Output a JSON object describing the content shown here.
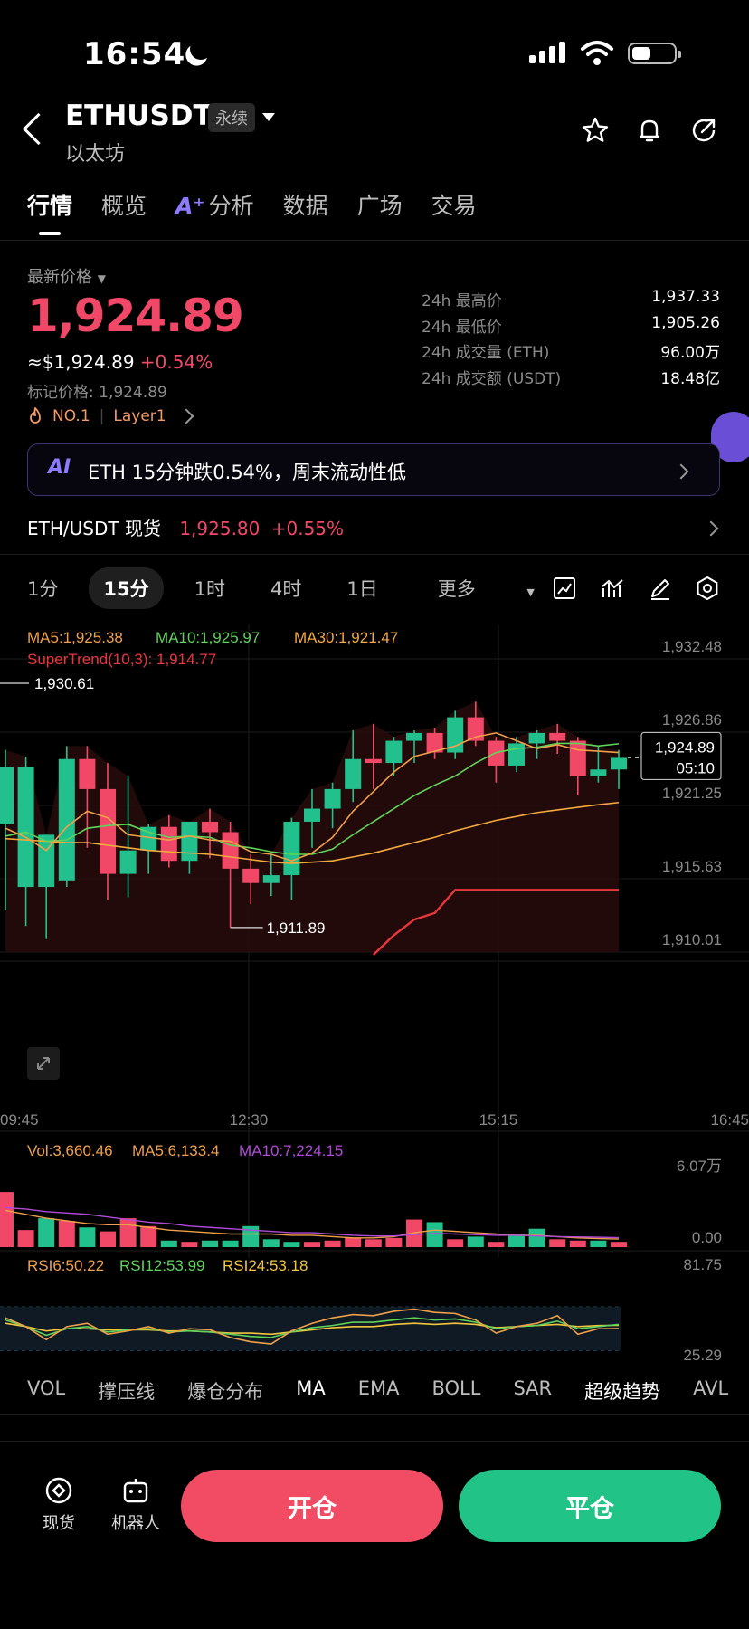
{
  "status": {
    "time": "16:54"
  },
  "header": {
    "symbol": "ETHUSDT",
    "type": "永续",
    "name": "以太坊"
  },
  "tabs": [
    "行情",
    "概览",
    "分析",
    "数据",
    "广场",
    "交易"
  ],
  "price": {
    "label": "最新价格",
    "last": "1,924.89",
    "usd": "≈$1,924.89",
    "change": "+0.54%",
    "mark": "标记价格: 1,924.89",
    "rank": "NO.1",
    "tag": "Layer1"
  },
  "stats": [
    {
      "k": "24h 最高价",
      "v": "1,937.33"
    },
    {
      "k": "24h 最低价",
      "v": "1,905.26"
    },
    {
      "k": "24h 成交量 (ETH)",
      "v": "96.00万"
    },
    {
      "k": "24h 成交额 (USDT)",
      "v": "18.48亿"
    }
  ],
  "banner": {
    "ai": "AI",
    "text": "ETH 15分钟跌0.54%，周末流动性低"
  },
  "spot": {
    "pair": "ETH/USDT 现货",
    "price": "1,925.80",
    "change": "+0.55%"
  },
  "intervals": [
    "1分",
    "15分",
    "1时",
    "4时",
    "1日",
    "更多"
  ],
  "indicators": [
    "VOL",
    "撑压线",
    "爆仓分布",
    "MA",
    "EMA",
    "BOLL",
    "SAR",
    "超级趋势",
    "AVL"
  ],
  "actions": {
    "spot": "现货",
    "bot": "机器人",
    "open": "开仓",
    "close": "平仓"
  },
  "colors": {
    "up": "#22c08c",
    "down": "#f24867",
    "ma5": "#f0a04a",
    "ma10": "#5fd35a",
    "ma30": "#f3a93e",
    "supertrend": "#e8363d"
  },
  "chart_data": {
    "type": "candlestick",
    "legend": {
      "ma5": "MA5:1,925.38",
      "ma10": "MA10:1,925.97",
      "ma30": "MA30:1,921.47",
      "supertrend": "SuperTrend(10,3): 1,914.77"
    },
    "y_ticks": [
      "1,932.48",
      "1,926.86",
      "1,921.25",
      "1,915.63",
      "1,910.01"
    ],
    "x_ticks": [
      "09:45",
      "12:30",
      "15:15",
      "16:45"
    ],
    "ylim": [
      1910.01,
      1932.48
    ],
    "last_price_label": "1,924.89",
    "countdown": "05:10",
    "high_marker": "1,930.61",
    "low_marker": "1,911.89",
    "candles": [
      {
        "o": 1919.8,
        "h": 1925.5,
        "l": 1913.2,
        "c": 1924.2
      },
      {
        "o": 1915.0,
        "h": 1925.0,
        "l": 1912.0,
        "c": 1924.2
      },
      {
        "o": 1915.0,
        "h": 1919.0,
        "l": 1911.0,
        "c": 1919.0
      },
      {
        "o": 1915.5,
        "h": 1925.8,
        "l": 1915.0,
        "c": 1924.8
      },
      {
        "o": 1924.8,
        "h": 1925.8,
        "l": 1918.0,
        "c": 1922.5
      },
      {
        "o": 1922.5,
        "h": 1924.5,
        "l": 1914.0,
        "c": 1916.0
      },
      {
        "o": 1916.0,
        "h": 1923.5,
        "l": 1914.2,
        "c": 1917.8
      },
      {
        "o": 1917.8,
        "h": 1919.8,
        "l": 1916.0,
        "c": 1919.6
      },
      {
        "o": 1919.6,
        "h": 1920.5,
        "l": 1916.5,
        "c": 1917.0
      },
      {
        "o": 1917.0,
        "h": 1920.0,
        "l": 1916.0,
        "c": 1920.0
      },
      {
        "o": 1920.0,
        "h": 1921.0,
        "l": 1917.2,
        "c": 1919.2
      },
      {
        "o": 1919.2,
        "h": 1920.0,
        "l": 1911.9,
        "c": 1916.4
      },
      {
        "o": 1916.4,
        "h": 1917.5,
        "l": 1913.7,
        "c": 1915.3
      },
      {
        "o": 1915.3,
        "h": 1917.5,
        "l": 1914.3,
        "c": 1915.9
      },
      {
        "o": 1915.9,
        "h": 1920.3,
        "l": 1914.0,
        "c": 1920.0
      },
      {
        "o": 1920.0,
        "h": 1922.5,
        "l": 1918.0,
        "c": 1921.0
      },
      {
        "o": 1921.0,
        "h": 1923.0,
        "l": 1919.5,
        "c": 1922.5
      },
      {
        "o": 1922.5,
        "h": 1927.0,
        "l": 1921.5,
        "c": 1924.8
      },
      {
        "o": 1924.8,
        "h": 1927.5,
        "l": 1922.5,
        "c": 1924.5
      },
      {
        "o": 1924.5,
        "h": 1926.5,
        "l": 1923.5,
        "c": 1926.2
      },
      {
        "o": 1926.2,
        "h": 1927.0,
        "l": 1924.5,
        "c": 1926.8
      },
      {
        "o": 1926.8,
        "h": 1927.2,
        "l": 1924.8,
        "c": 1925.3
      },
      {
        "o": 1925.3,
        "h": 1928.5,
        "l": 1924.8,
        "c": 1928.0
      },
      {
        "o": 1928.0,
        "h": 1929.2,
        "l": 1925.8,
        "c": 1926.2
      },
      {
        "o": 1926.2,
        "h": 1926.5,
        "l": 1923.0,
        "c": 1924.3
      },
      {
        "o": 1924.3,
        "h": 1926.5,
        "l": 1923.8,
        "c": 1926.0
      },
      {
        "o": 1926.0,
        "h": 1927.0,
        "l": 1924.8,
        "c": 1926.8
      },
      {
        "o": 1926.8,
        "h": 1927.5,
        "l": 1925.2,
        "c": 1926.2
      },
      {
        "o": 1926.2,
        "h": 1926.5,
        "l": 1922.0,
        "c": 1923.5
      },
      {
        "o": 1923.5,
        "h": 1925.8,
        "l": 1923.0,
        "c": 1924.0
      },
      {
        "o": 1924.0,
        "h": 1925.5,
        "l": 1922.5,
        "c": 1924.89
      }
    ],
    "ma5": [
      1919.5,
      1918.8,
      1917.8,
      1919.6,
      1920.8,
      1920.3,
      1919.0,
      1918.8,
      1918.6,
      1918.9,
      1918.6,
      1918.5,
      1917.7,
      1917.5,
      1917.0,
      1917.6,
      1918.8,
      1920.8,
      1922.3,
      1923.8,
      1925.0,
      1925.4,
      1925.8,
      1926.5,
      1926.8,
      1926.2,
      1925.6,
      1925.9,
      1925.5,
      1925.4,
      1925.3
    ],
    "ma10": [
      1918.9,
      1919.2,
      1918.5,
      1918.6,
      1919.5,
      1919.7,
      1919.8,
      1919.2,
      1918.8,
      1918.9,
      1918.8,
      1918.2,
      1918.0,
      1917.7,
      1917.5,
      1917.5,
      1917.9,
      1919.0,
      1920.0,
      1921.0,
      1922.0,
      1922.8,
      1923.5,
      1924.5,
      1925.3,
      1925.6,
      1925.7,
      1926.0,
      1926.0,
      1925.8,
      1925.97
    ],
    "ma30": [
      1918.7,
      1918.6,
      1918.5,
      1918.4,
      1918.4,
      1918.2,
      1918.0,
      1917.8,
      1917.7,
      1917.6,
      1917.5,
      1917.3,
      1917.1,
      1916.9,
      1916.8,
      1916.9,
      1917.0,
      1917.3,
      1917.6,
      1918.0,
      1918.4,
      1918.8,
      1919.3,
      1919.7,
      1920.1,
      1920.4,
      1920.7,
      1920.9,
      1921.1,
      1921.3,
      1921.47
    ],
    "supertrend": [
      null,
      null,
      null,
      null,
      null,
      null,
      null,
      null,
      null,
      null,
      null,
      null,
      null,
      null,
      null,
      null,
      null,
      null,
      1909.8,
      1911.3,
      1912.5,
      1913.0,
      1914.77,
      1914.77,
      1914.77,
      1914.77,
      1914.77,
      1914.77,
      1914.77,
      1914.77,
      1914.77
    ],
    "volume": {
      "legend": {
        "vol": "Vol:3,660.46",
        "ma5": "MA5:6,133.4",
        "ma10": "MA10:7,224.15"
      },
      "ticks": [
        "6.07万",
        "0.00"
      ],
      "max": 60700,
      "values": [
        42000,
        13000,
        22000,
        20000,
        15000,
        12000,
        22000,
        16000,
        5000,
        4000,
        5000,
        5000,
        16000,
        6000,
        4000,
        4000,
        5000,
        7000,
        6000,
        7000,
        21000,
        19000,
        6000,
        8000,
        4000,
        10000,
        14000,
        6000,
        5000,
        5000,
        4000
      ],
      "up": [
        false,
        false,
        true,
        false,
        true,
        false,
        false,
        false,
        true,
        false,
        true,
        true,
        true,
        true,
        true,
        false,
        false,
        false,
        false,
        false,
        false,
        true,
        false,
        true,
        false,
        true,
        true,
        false,
        false,
        true,
        false
      ],
      "ma5": [
        28000,
        25000,
        22000,
        20000,
        18000,
        17000,
        17000,
        15000,
        13000,
        12000,
        11000,
        10000,
        10000,
        10000,
        9000,
        9000,
        8000,
        7000,
        7000,
        8000,
        11000,
        13000,
        12000,
        11000,
        10000,
        9000,
        9000,
        8000,
        7000,
        6500,
        6133
      ],
      "ma10": [
        30000,
        29000,
        27000,
        26000,
        25000,
        23000,
        21000,
        19000,
        18000,
        16000,
        15000,
        14000,
        13000,
        12000,
        11000,
        11000,
        10000,
        9000,
        8500,
        8500,
        9500,
        10500,
        10000,
        9500,
        9000,
        9000,
        8500,
        8000,
        7800,
        7500,
        7224
      ]
    },
    "rsi": {
      "legend": {
        "rsi6": "RSI6:50.22",
        "rsi12": "RSI12:53.99",
        "rsi24": "RSI24:53.18"
      },
      "ticks": [
        "81.75",
        "25.29"
      ],
      "range": [
        25.29,
        81.75
      ],
      "rsi6": [
        60,
        52,
        40,
        52,
        55,
        45,
        48,
        52,
        46,
        50,
        49,
        42,
        38,
        36,
        48,
        55,
        60,
        63,
        62,
        66,
        68,
        65,
        64,
        58,
        46,
        52,
        55,
        62,
        45,
        50,
        50.22
      ],
      "rsi12": [
        58,
        52,
        44,
        50,
        52,
        47,
        49,
        50,
        47,
        48,
        47,
        45,
        43,
        42,
        47,
        51,
        53,
        56,
        56,
        58,
        60,
        58,
        59,
        56,
        50,
        52,
        53,
        57,
        50,
        52,
        53.99
      ],
      "rsi24": [
        55,
        52,
        48,
        50,
        50,
        49,
        49,
        49,
        48,
        48,
        47,
        46,
        46,
        45,
        47,
        49,
        51,
        52,
        52,
        54,
        55,
        54,
        55,
        54,
        51,
        52,
        53,
        54,
        52,
        53,
        53.18
      ]
    }
  }
}
